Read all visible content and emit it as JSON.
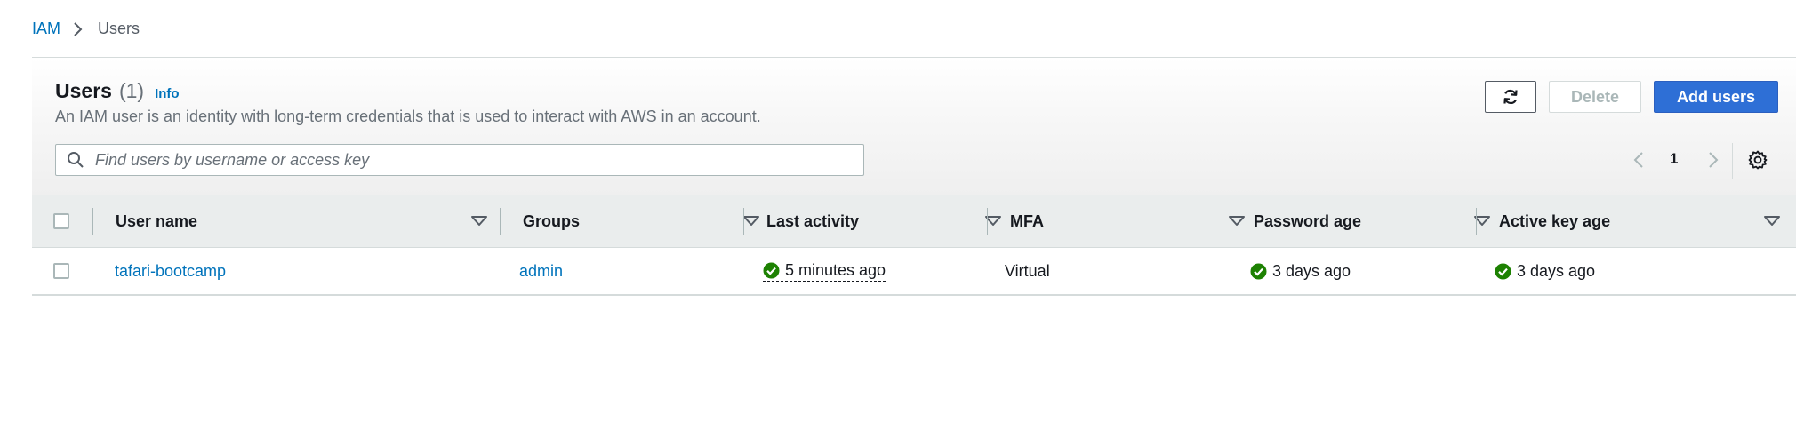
{
  "breadcrumb": {
    "root": "IAM",
    "current": "Users"
  },
  "panel": {
    "title": "Users",
    "count": "(1)",
    "info": "Info",
    "description": "An IAM user is an identity with long-term credentials that is used to interact with AWS in an account."
  },
  "actions": {
    "refresh_icon": "refresh-icon",
    "delete": "Delete",
    "add": "Add users"
  },
  "search": {
    "placeholder": "Find users by username or access key",
    "value": ""
  },
  "pagination": {
    "current_page": "1"
  },
  "columns": [
    "User name",
    "Groups",
    "Last activity",
    "MFA",
    "Password age",
    "Active key age"
  ],
  "rows": [
    {
      "user_name": "tafari-bootcamp",
      "groups": "admin",
      "last_activity": "5 minutes ago",
      "mfa": "Virtual",
      "password_age": "3 days ago",
      "active_key_age": "3 days ago"
    }
  ],
  "colors": {
    "link": "#0073bb",
    "primary": "#2e6fd6",
    "success": "#1d8102",
    "header_bg": "#eaeded"
  }
}
